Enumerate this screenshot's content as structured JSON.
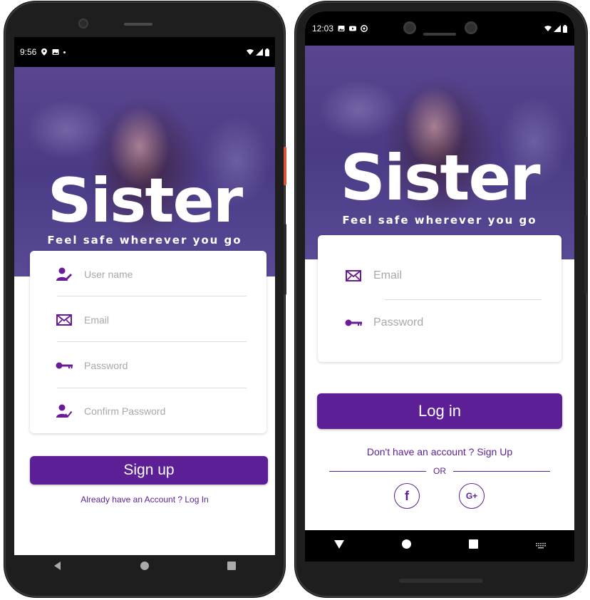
{
  "signup_screen": {
    "status_bar": {
      "time": "9:56"
    },
    "hero": {
      "brand": "Sister",
      "tagline": "Feel safe wherever you go"
    },
    "form": {
      "username_placeholder": "User name",
      "email_placeholder": "Email",
      "password_placeholder": "Password",
      "confirm_password_placeholder": "Confirm Password"
    },
    "signup_button": "Sign up",
    "login_link": "Already have an Account ? Log In"
  },
  "login_screen": {
    "status_bar": {
      "time": "12:03"
    },
    "hero": {
      "brand": "Sister",
      "tagline": "Feel safe wherever you go"
    },
    "form": {
      "email_placeholder": "Email",
      "password_placeholder": "Password"
    },
    "login_button": "Log in",
    "signup_link": "Don't have an account ? Sign Up",
    "divider_text": "OR",
    "social": {
      "facebook": "f",
      "google": "G+"
    }
  },
  "colors": {
    "accent": "#5c1f96",
    "hero_overlay": "#4b3a85",
    "placeholder": "#a8a8a8"
  },
  "icons": [
    "user-edit-icon",
    "mail-icon",
    "key-icon",
    "user-check-icon",
    "facebook-icon",
    "google-plus-icon",
    "location-icon",
    "photo-icon",
    "youtube-icon",
    "wifi-icon",
    "signal-icon",
    "battery-icon",
    "back-icon",
    "home-icon",
    "recents-icon",
    "keyboard-icon"
  ]
}
